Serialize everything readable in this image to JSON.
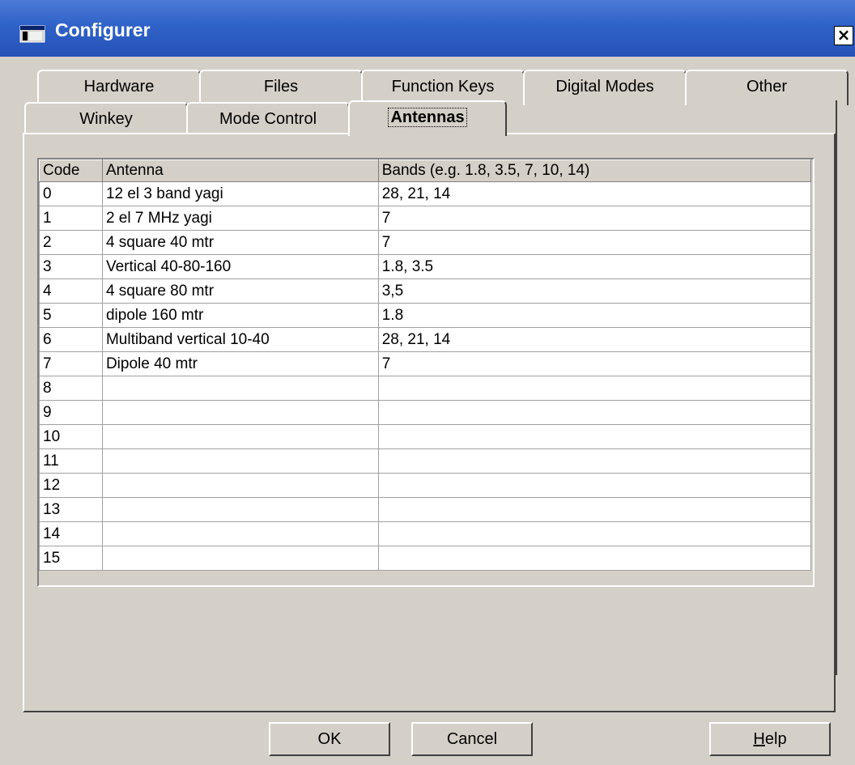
{
  "window": {
    "title": "Configurer",
    "close_glyph": "×"
  },
  "tabs": {
    "row1": [
      "Hardware",
      "Files",
      "Function Keys",
      "Digital Modes",
      "Other"
    ],
    "row2": [
      "Winkey",
      "Mode Control",
      "Antennas"
    ],
    "active": "Antennas"
  },
  "grid": {
    "columns": [
      "Code",
      "Antenna",
      "Bands (e.g. 1.8, 3.5, 7, 10, 14)"
    ],
    "rows": [
      [
        "0",
        "12 el 3 band yagi",
        "28, 21, 14"
      ],
      [
        "1",
        "2 el 7 MHz yagi",
        "7"
      ],
      [
        "2",
        "4 square 40 mtr",
        "7"
      ],
      [
        "3",
        "Vertical 40-80-160",
        "1.8, 3.5"
      ],
      [
        "4",
        "4 square 80 mtr",
        "3,5"
      ],
      [
        "5",
        "dipole 160 mtr",
        "1.8"
      ],
      [
        "6",
        "Multiband vertical 10-40",
        "28, 21, 14"
      ],
      [
        "7",
        "Dipole 40 mtr",
        "7"
      ],
      [
        "8",
        "",
        ""
      ],
      [
        "9",
        "",
        ""
      ],
      [
        "10",
        "",
        ""
      ],
      [
        "11",
        "",
        ""
      ],
      [
        "12",
        "",
        ""
      ],
      [
        "13",
        "",
        ""
      ],
      [
        "14",
        "",
        ""
      ],
      [
        "15",
        "",
        ""
      ]
    ]
  },
  "buttons": {
    "ok": "OK",
    "cancel": "Cancel",
    "help_first": "H",
    "help_rest": "elp"
  },
  "colors": {
    "titlebar": "#2f62c8",
    "face": "#d4d0c8"
  }
}
